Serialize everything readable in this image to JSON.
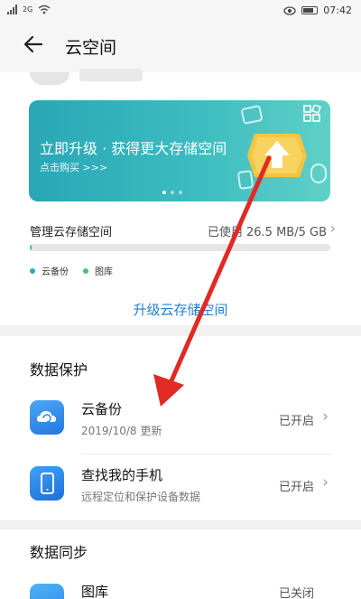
{
  "status_bar": {
    "network_label": "2G",
    "time": "07:42"
  },
  "header": {
    "title": "云空间",
    "back_icon": "back-arrow-icon"
  },
  "banner": {
    "title": "立即升级 · 获得更大存储空间",
    "subtitle": "点击购买 >>>",
    "page_count": 3,
    "active_page": 1,
    "colors": {
      "start": "#2aa6b6",
      "end": "#5fd0c7",
      "shield": "#f5c542"
    }
  },
  "storage": {
    "label": "管理云存储空间",
    "used_text": "已使用 26.5 MB/5 GB",
    "used_fraction": 0.005,
    "legend": [
      {
        "label": "云备份",
        "color": "#2fa9c0"
      },
      {
        "label": "图库",
        "color": "#47c36c"
      }
    ],
    "upgrade_label": "升级云存储空间"
  },
  "data_protection": {
    "title": "数据保护",
    "items": [
      {
        "title": "云备份",
        "subtitle": "2019/10/8 更新",
        "status": "已开启",
        "icon": "cloud-backup-icon"
      },
      {
        "title": "查找我的手机",
        "subtitle": "远程定位和保护设备数据",
        "status": "已开启",
        "icon": "find-phone-icon"
      }
    ]
  },
  "data_sync": {
    "title": "数据同步",
    "items": [
      {
        "title": "图库",
        "status": "已关闭",
        "icon": "gallery-icon"
      }
    ]
  },
  "annotation": {
    "color": "#e02a24"
  },
  "accent_color": "#1f7fd6"
}
